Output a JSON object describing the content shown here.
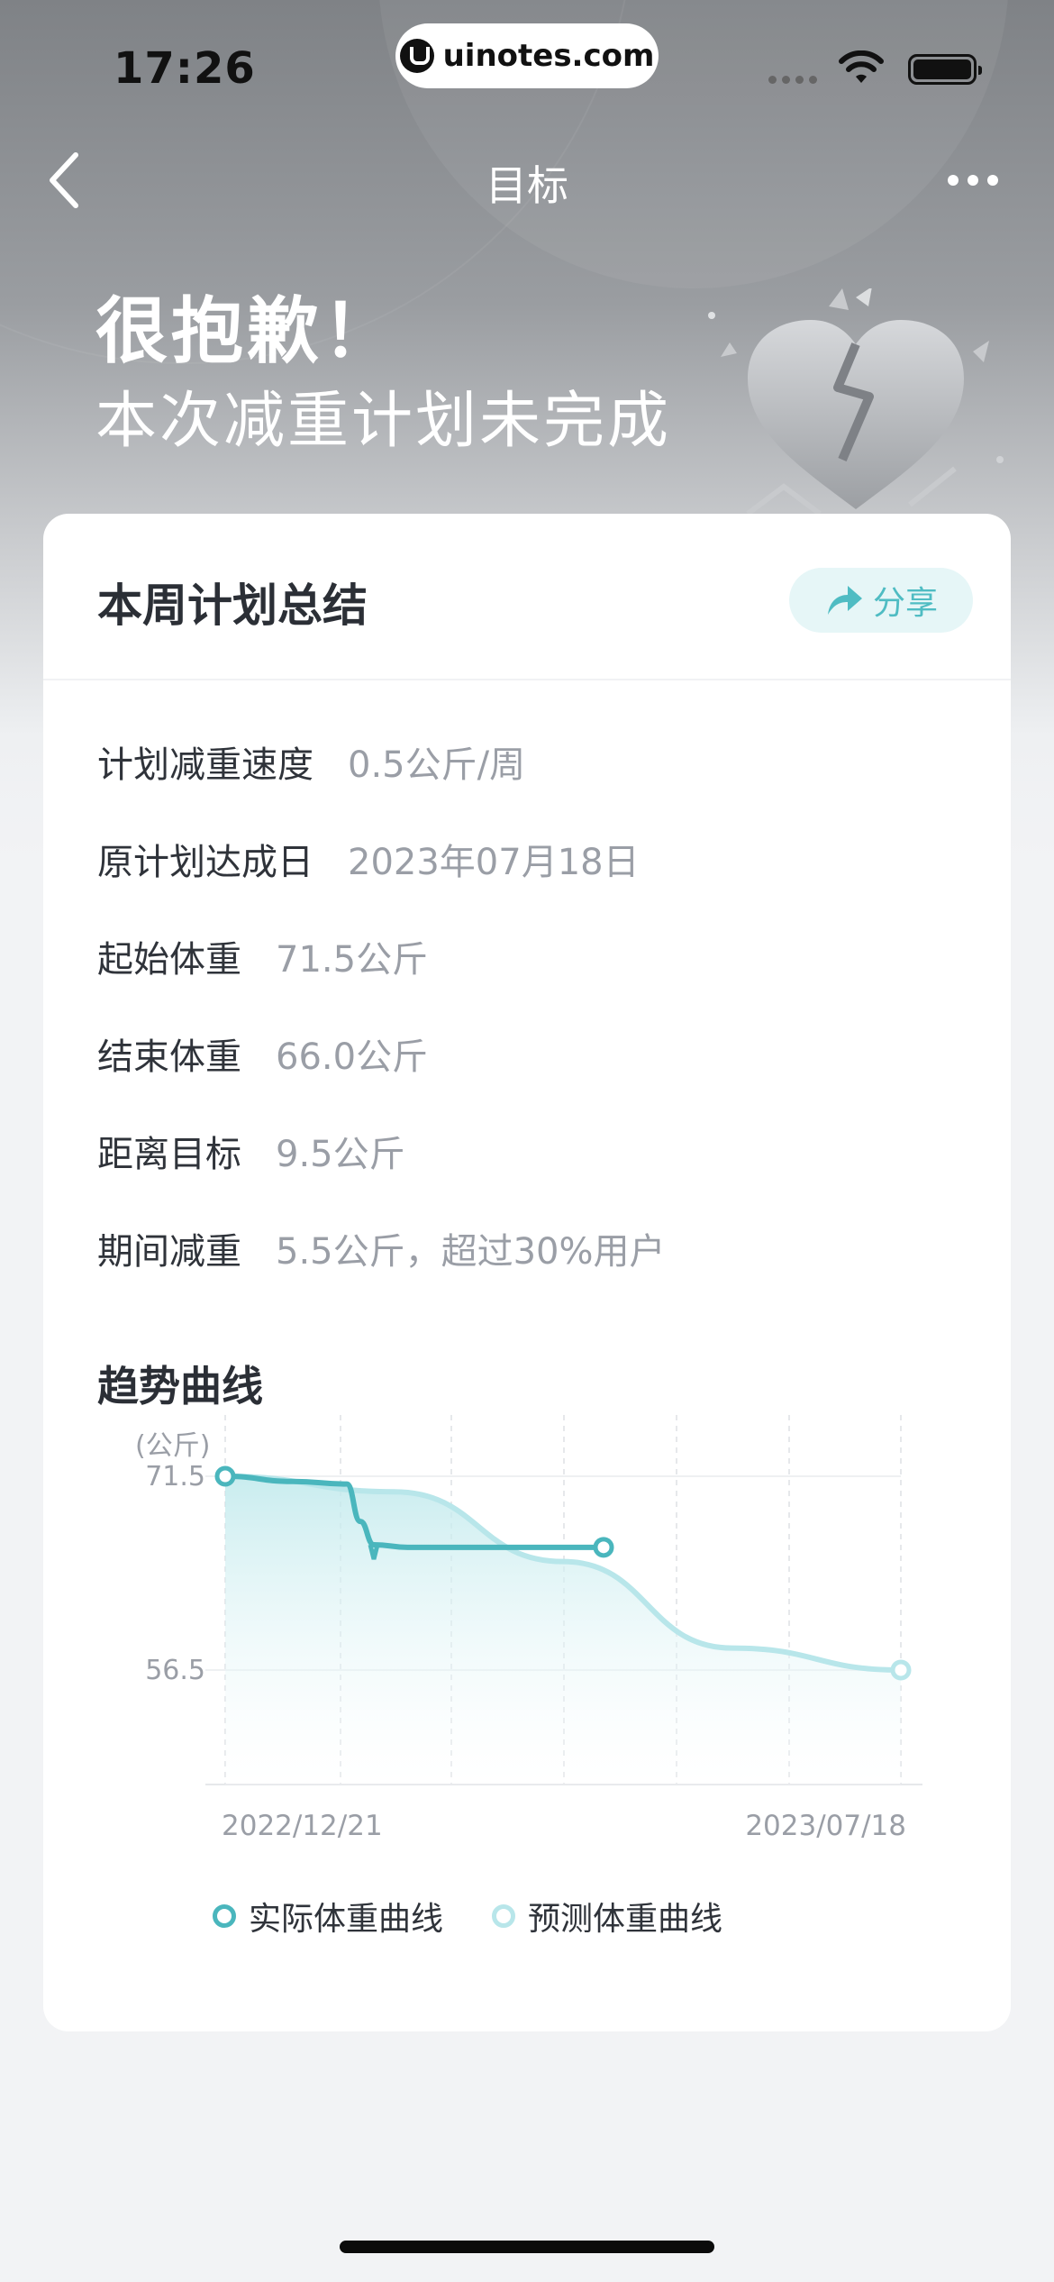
{
  "status_bar": {
    "time": "17:26",
    "url": "uinotes.com"
  },
  "nav": {
    "title": "目标"
  },
  "headline": {
    "line1": "很抱歉！",
    "line2": "本次减重计划未完成"
  },
  "card": {
    "title": "本周计划总结",
    "share_label": "分享",
    "rows": [
      {
        "label": "计划减重速度",
        "value": "0.5公斤/周"
      },
      {
        "label": "原计划达成日",
        "value": "2023年07月18日"
      },
      {
        "label": "起始体重",
        "value": "71.5公斤"
      },
      {
        "label": "结束体重",
        "value": "66.0公斤"
      },
      {
        "label": "距离目标",
        "value": "9.5公斤"
      },
      {
        "label": "期间减重",
        "value": "5.5公斤，超过30%用户"
      }
    ],
    "trend_title": "趋势曲线"
  },
  "colors": {
    "accent": "#4ab6bd",
    "predicted": "#b8e6ea",
    "share_bg": "#e6f6f7"
  },
  "chart_data": {
    "type": "line",
    "ylabel": "(公斤)",
    "y_ticks": [
      71.5,
      56.5
    ],
    "y_tick_labels": [
      "71.5",
      "56.5"
    ],
    "x_tick_labels": [
      "2022/12/21",
      "2023/07/18"
    ],
    "ylim": [
      50,
      76
    ],
    "series": [
      {
        "name": "实际体重曲线",
        "x": [
          0,
          0.1,
          0.18,
          0.2,
          0.22,
          0.27,
          0.56
        ],
        "values": [
          71.5,
          71.1,
          70.9,
          68.0,
          66.2,
          66.0,
          66.0
        ]
      },
      {
        "name": "预测体重曲线",
        "x": [
          0,
          0.25,
          0.5,
          0.75,
          1.0
        ],
        "values": [
          71.5,
          70.3,
          64.9,
          58.2,
          56.5
        ]
      }
    ],
    "legend_position": "bottom",
    "grid": true
  }
}
